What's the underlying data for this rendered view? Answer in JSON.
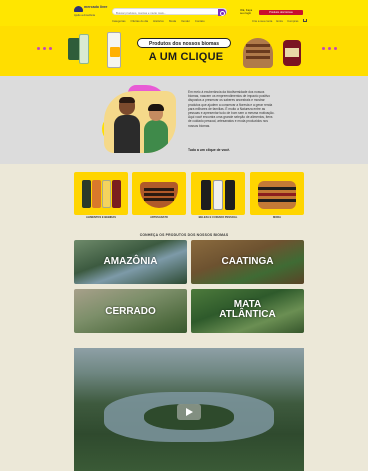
{
  "header": {
    "logo_title": "mercado livre",
    "logo_subtitle": "Ajude a Amazônia",
    "search_placeholder": "Buscar produtos, marcas e muito mais...",
    "signin_line1": "Olá, Faça",
    "signin_line2": "seu login",
    "cta_label": "Produtos dos biomas",
    "nav": [
      "Categorias",
      "Ofertas do dia",
      "Histórico",
      "Moda",
      "Vender",
      "Contato"
    ],
    "nav_right": [
      "Crie a sua conta",
      "Entre",
      "Compras"
    ]
  },
  "hero": {
    "pill": "Produtos dos nossos biomas",
    "title": "A UM CLIQUE"
  },
  "about": {
    "text": "Em meio à exuberância da biodiversidade dos nossos biomas, nascem os empreendimentos de impacto positivo dispostos a preservar os saberes ancestrais e mostrar produtos que ajudem a conservar a floresta e a gerar renda para milhares de famílias. É muito a Natureza entre as pessoas e apresentar tudo de bom sem a mesma motivação. Aqui você encontra uma grande seleção de alimentos, itens de cuidado pessoal, artesanatos e moda produzidos nos nossos biomas.",
    "tagline": "Tudo a um clique de você."
  },
  "categories": [
    {
      "label": "ALIMENTOS E BEBIDAS"
    },
    {
      "label": "ARTESANATO"
    },
    {
      "label": "BELEZA E CUIDADO PESSOAL"
    },
    {
      "label": "MODA"
    }
  ],
  "biomas": {
    "title": "CONHEÇA OS PRODUTOS DOS NOSSOS BIOMAS",
    "items": [
      {
        "label": "AMAZÔNIA"
      },
      {
        "label": "CAATINGA"
      },
      {
        "label": "CERRADO"
      },
      {
        "label": "MATA ATLÂNTICA"
      }
    ]
  },
  "colors": {
    "header_yellow": "#ffe600",
    "accent_purple": "#7b2cbf",
    "accent_red": "#c8102e",
    "pink": "#e85bd5"
  }
}
